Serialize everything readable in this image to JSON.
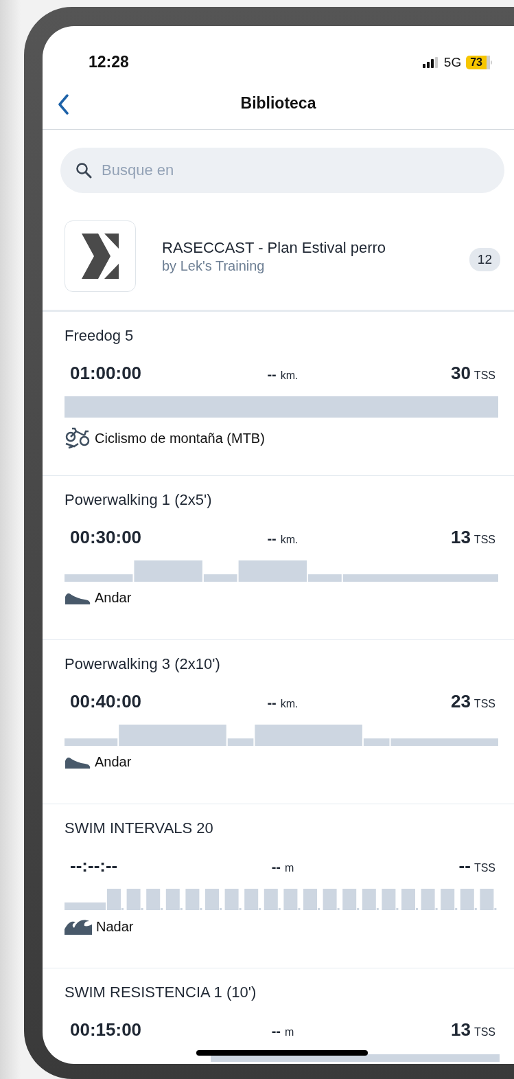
{
  "status_bar": {
    "time": "12:28",
    "network": "5G",
    "battery": "73"
  },
  "header": {
    "title": "Biblioteca"
  },
  "search": {
    "placeholder": "Busque en"
  },
  "plan": {
    "title": "RASECCAST - Plan Estival perro",
    "author": "by Lek's Training",
    "count": "12"
  },
  "workouts": [
    {
      "title": "Freedog 5",
      "time": "01:00:00",
      "distance": "--",
      "distance_unit": "km.",
      "tss": "30",
      "tss_unit": "TSS",
      "kind": "mtb",
      "sport": "Ciclismo de montaña (MTB)"
    },
    {
      "title": "Powerwalking 1 (2x5')",
      "time": "00:30:00",
      "distance": "--",
      "distance_unit": "km.",
      "tss": "13",
      "tss_unit": "TSS",
      "kind": "walk",
      "sport": "Andar"
    },
    {
      "title": "Powerwalking 3 (2x10')",
      "time": "00:40:00",
      "distance": "--",
      "distance_unit": "km.",
      "tss": "23",
      "tss_unit": "TSS",
      "kind": "walk",
      "sport": "Andar"
    },
    {
      "title": "SWIM INTERVALS 20",
      "time": "--:--:--",
      "distance": "--",
      "distance_unit": "m",
      "tss": "--",
      "tss_unit": "TSS",
      "kind": "swim",
      "sport": "Nadar"
    },
    {
      "title": "SWIM RESISTENCIA 1 (10')",
      "time": "00:15:00",
      "distance": "--",
      "distance_unit": "m",
      "tss": "13",
      "tss_unit": "TSS",
      "kind": "swim"
    }
  ]
}
